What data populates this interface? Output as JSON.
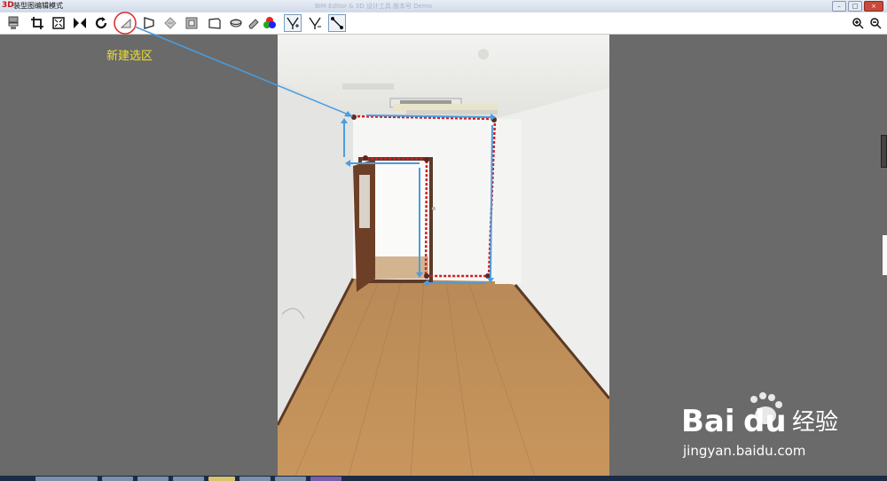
{
  "window": {
    "title": "装型图编辑模式",
    "blurred_title": "BIM  Editor & 3D  设计工具  版本号  Demo",
    "app_icon": "3D"
  },
  "window_controls": [
    "minimize",
    "maximize",
    "close"
  ],
  "toolbar": {
    "tools": [
      {
        "name": "layers-icon"
      },
      {
        "name": "crop-icon"
      },
      {
        "name": "fit-icon"
      },
      {
        "name": "flip-icon"
      },
      {
        "name": "rotate-icon"
      },
      {
        "name": "new-selection-icon"
      },
      {
        "name": "perspective-icon"
      },
      {
        "name": "diamond-icon"
      },
      {
        "name": "frame-icon"
      },
      {
        "name": "box-icon"
      },
      {
        "name": "ellipse-icon"
      },
      {
        "name": "eraser-icon"
      },
      {
        "name": "color-icon"
      },
      {
        "name": "tree-add-icon"
      },
      {
        "name": "tree-remove-icon"
      },
      {
        "name": "line-tool-icon"
      }
    ],
    "zoom": [
      "zoom-in-icon",
      "zoom-out-icon"
    ]
  },
  "annotation": {
    "label": "新建选区",
    "color": "#f2df2a",
    "circle_color": "#e03030",
    "arrow_color": "#4a9de0"
  },
  "watermark": {
    "brand": "Bai",
    "brand2": "du",
    "cn": "经验",
    "url": "jingyan.baidu.com"
  },
  "colors": {
    "background": "#6a6a6a",
    "selection_outline": "#cc1f1f"
  }
}
